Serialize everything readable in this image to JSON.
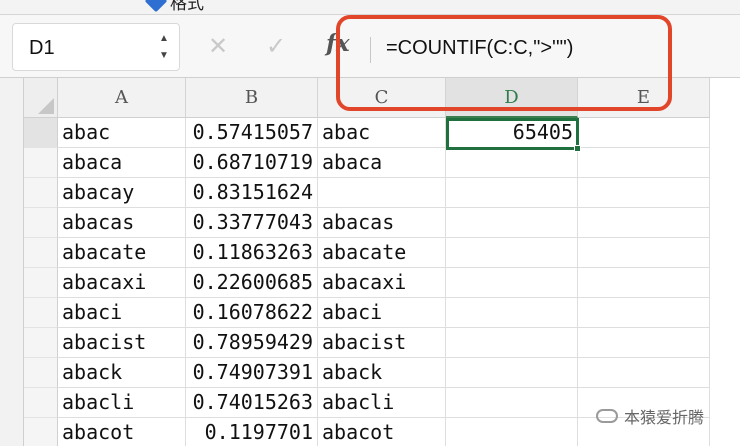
{
  "ribbon": {
    "label": "格式",
    "icon": "paintbrush-icon"
  },
  "formula_bar": {
    "name_box": "D1",
    "cancel_icon": "✕",
    "enter_icon": "✓",
    "fx_label": "fx",
    "formula": "=COUNTIF(C:C,\">''\")",
    "highlight_color": "#e2462a"
  },
  "sheet": {
    "columns": [
      {
        "letter": "A",
        "width": 128
      },
      {
        "letter": "B",
        "width": 132
      },
      {
        "letter": "C",
        "width": 128
      },
      {
        "letter": "D",
        "width": 132
      },
      {
        "letter": "E",
        "width": 132
      }
    ],
    "active_column": "D",
    "selected_cell": "D1",
    "selection_color": "#1f6f3f",
    "rows": [
      [
        "abac",
        "0.57415057",
        "abac",
        "65405",
        ""
      ],
      [
        "abaca",
        "0.68710719",
        "abaca",
        "",
        ""
      ],
      [
        "abacay",
        "0.83151624",
        "",
        "",
        ""
      ],
      [
        "abacas",
        "0.33777043",
        "abacas",
        "",
        ""
      ],
      [
        "abacate",
        "0.11863263",
        "abacate",
        "",
        ""
      ],
      [
        "abacaxi",
        "0.22600685",
        "abacaxi",
        "",
        ""
      ],
      [
        "abaci",
        "0.16078622",
        "abaci",
        "",
        ""
      ],
      [
        "abacist",
        "0.78959429",
        "abacist",
        "",
        ""
      ],
      [
        "aback",
        "0.74907391",
        "aback",
        "",
        ""
      ],
      [
        "abacli",
        "0.74015263",
        "abacli",
        "",
        ""
      ],
      [
        "abacot",
        "0.1197701",
        "abacot",
        "",
        ""
      ]
    ]
  },
  "watermark": "本猿爱折腾"
}
